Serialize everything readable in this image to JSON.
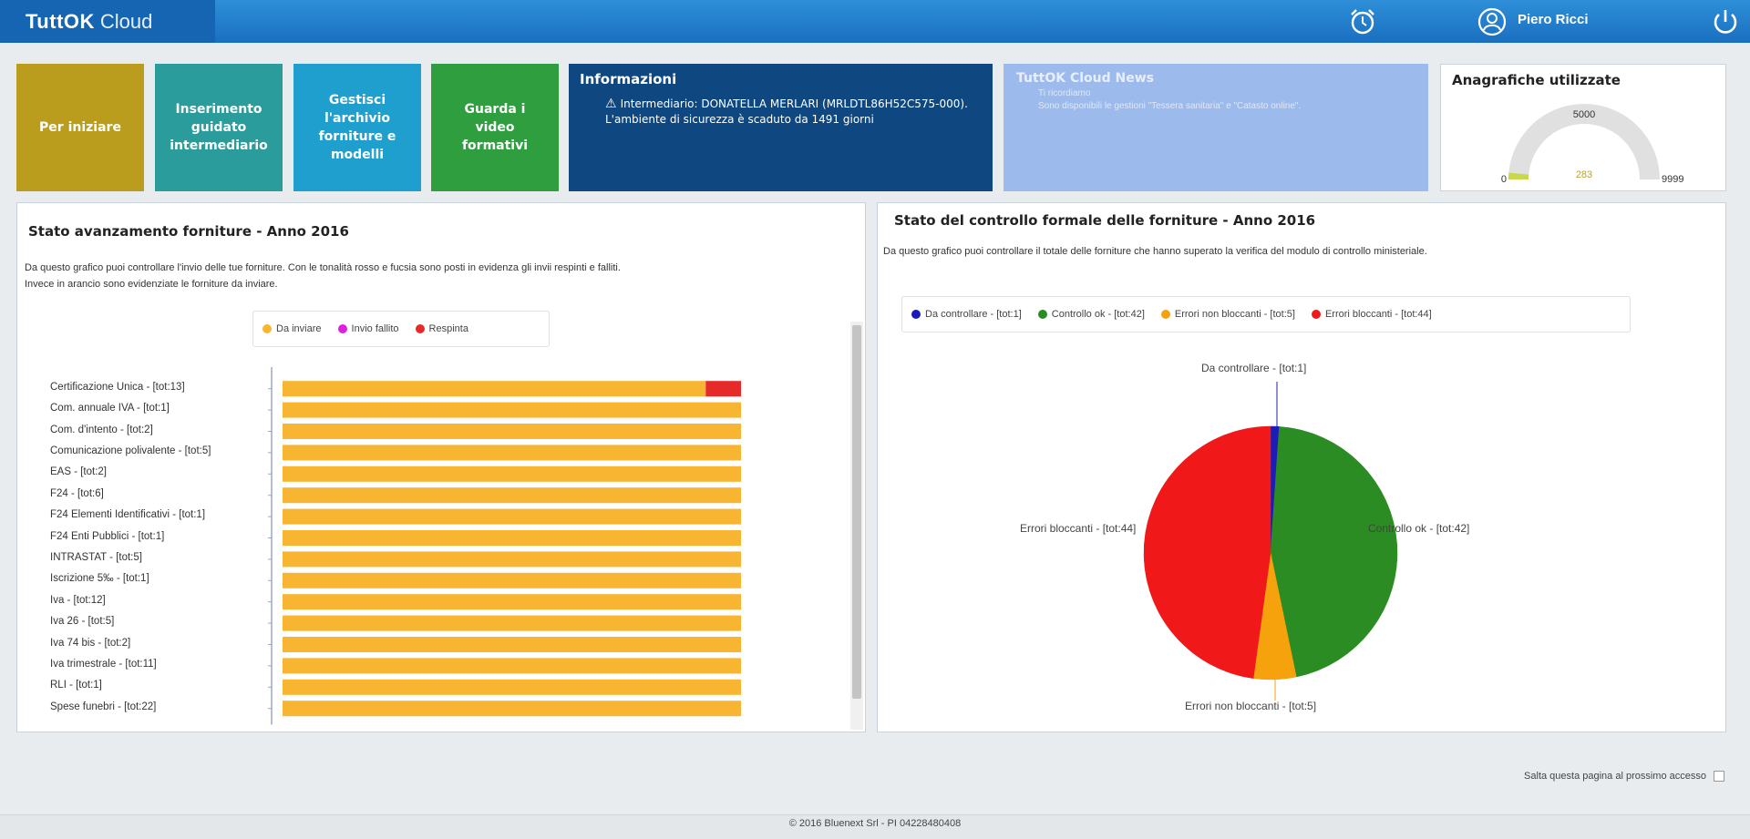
{
  "header": {
    "logo_strong": "TuttOK",
    "logo_light": "Cloud",
    "user_name": "Piero Ricci",
    "icons": [
      "alarm-clock-icon",
      "user-icon",
      "power-icon"
    ]
  },
  "tiles": [
    {
      "label": "Per iniziare",
      "color": "#bb9d1d"
    },
    {
      "label": "Inserimento guidato intermediario",
      "color": "#2a9c9c"
    },
    {
      "label": "Gestisci l'archivio forniture e modelli",
      "color": "#1e9fce"
    },
    {
      "label": "Guarda i video formativi",
      "color": "#2e9e3f"
    }
  ],
  "info": {
    "title": "Informazioni",
    "text": "Intermediario: DONATELLA MERLARI (MRLDTL86H52C575-000). L'ambiente di sicurezza è scaduto da 1491 giorni"
  },
  "news": {
    "title": "TuttOK Cloud News",
    "line1": "Ti ricordiamo",
    "line2": "Sono disponibili le gestioni \"Tessera sanitaria\" e \"Catasto online\"."
  },
  "anagrafiche": {
    "title": "Anagrafiche utilizzate",
    "value": 283,
    "min_label": "0",
    "max_label": "9999",
    "mid_label": "5000",
    "value_label": "283",
    "min": 0,
    "max": 9999
  },
  "left_panel": {
    "title": "Stato avanzamento forniture - Anno 2016",
    "desc_line1": "Da questo grafico puoi controllare l'invio delle tue forniture. Con le tonalità rosso e fucsia sono posti in evidenza gli invii respinti e falliti.",
    "desc_line2": "Invece in arancio sono evidenziate le forniture da inviare."
  },
  "right_panel": {
    "title": "Stato del controllo formale delle forniture - Anno 2016",
    "desc": "Da questo grafico puoi controllare il totale delle forniture che hanno superato la verifica del modulo di controllo ministeriale."
  },
  "chart_data": [
    {
      "type": "bar",
      "orientation": "horizontal",
      "stacked": true,
      "legend_position": "top",
      "categories": [
        "Certificazione Unica - [tot:13]",
        "Com. annuale IVA - [tot:1]",
        "Com. d'intento - [tot:2]",
        "Comunicazione polivalente - [tot:5]",
        "EAS - [tot:2]",
        "F24 - [tot:6]",
        "F24 Elementi Identificativi - [tot:1]",
        "F24 Enti Pubblici - [tot:1]",
        "INTRASTAT - [tot:5]",
        "Iscrizione 5‰ - [tot:1]",
        "Iva - [tot:12]",
        "Iva 26 - [tot:5]",
        "Iva 74 bis - [tot:2]",
        "Iva trimestrale - [tot:11]",
        "RLI - [tot:1]",
        "Spese funebri - [tot:22]"
      ],
      "series": [
        {
          "name": "Da inviare",
          "color": "#f7b532",
          "values": [
            12,
            1,
            2,
            5,
            2,
            6,
            1,
            1,
            5,
            1,
            12,
            5,
            2,
            11,
            1,
            22
          ]
        },
        {
          "name": "Invio fallito",
          "color": "#e020e0",
          "values": [
            0,
            0,
            0,
            0,
            0,
            0,
            0,
            0,
            0,
            0,
            0,
            0,
            0,
            0,
            0,
            0
          ]
        },
        {
          "name": "Respinta",
          "color": "#e62a2a",
          "values": [
            1,
            0,
            0,
            0,
            0,
            0,
            0,
            0,
            0,
            0,
            0,
            0,
            0,
            0,
            0,
            0
          ]
        }
      ]
    },
    {
      "type": "pie",
      "legend_position": "top",
      "slices": [
        {
          "name": "Da controllare - [tot:1]",
          "value": 1,
          "color": "#1c1cb8"
        },
        {
          "name": "Controllo ok - [tot:42]",
          "value": 42,
          "color": "#2a8c22"
        },
        {
          "name": "Errori non bloccanti - [tot:5]",
          "value": 5,
          "color": "#f5a20c"
        },
        {
          "name": "Errori bloccanti - [tot:44]",
          "value": 44,
          "color": "#f01818"
        }
      ]
    }
  ],
  "footer": {
    "skip_label": "Salta questa pagina al prossimo accesso",
    "copyright": "© 2016 Bluenext Srl - PI 04228480408"
  }
}
